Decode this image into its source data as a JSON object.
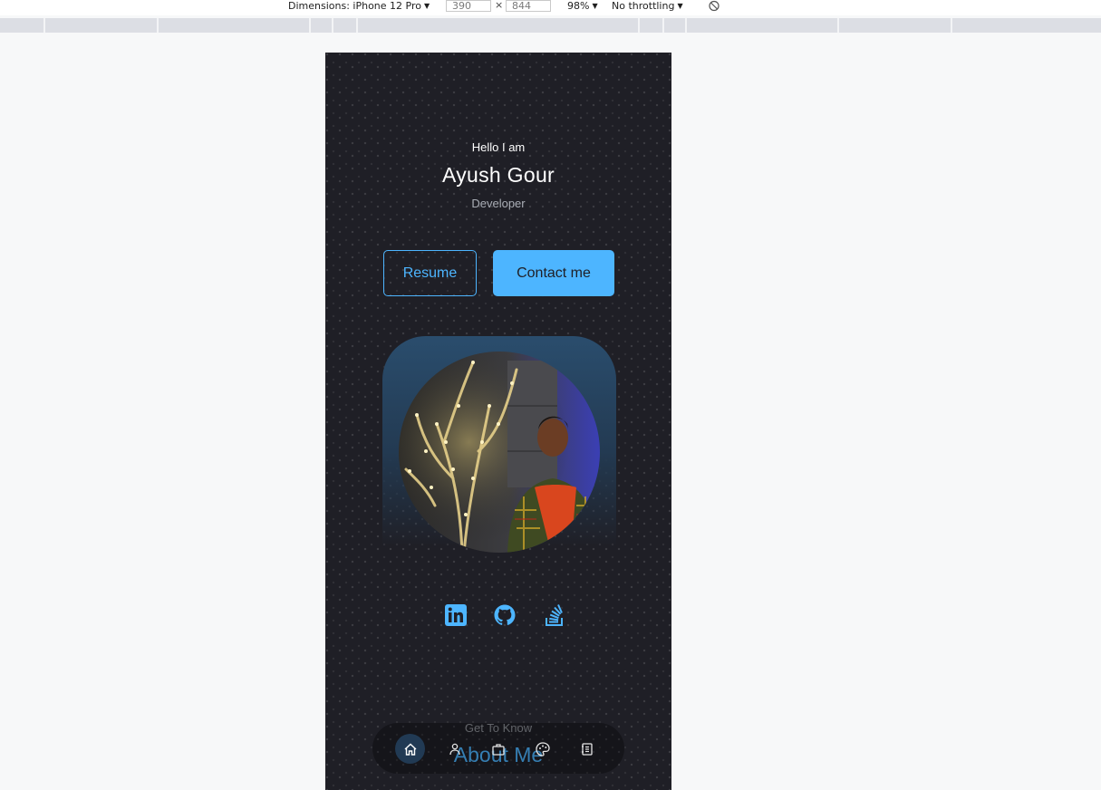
{
  "devtools": {
    "dimensions_label": "Dimensions: iPhone 12 Pro",
    "width": "390",
    "times": "×",
    "height": "844",
    "zoom": "98%",
    "throttling": "No throttling"
  },
  "hero": {
    "greeting": "Hello I am",
    "name": "Ayush Gour",
    "role": "Developer"
  },
  "buttons": {
    "resume": "Resume",
    "contact": "Contact me"
  },
  "socials": [
    {
      "icon": "linkedin-icon"
    },
    {
      "icon": "github-icon"
    },
    {
      "icon": "stackoverflow-icon"
    }
  ],
  "about": {
    "subtitle": "Get To Know",
    "title": "About Me"
  },
  "nav": {
    "items": [
      "home-icon",
      "user-icon",
      "briefcase-icon",
      "palette-icon",
      "contact-book-icon"
    ],
    "active": "home-icon"
  },
  "colors": {
    "accent": "#4db5ff",
    "background": "#1f1f26",
    "frame": "#2a4d6d"
  }
}
